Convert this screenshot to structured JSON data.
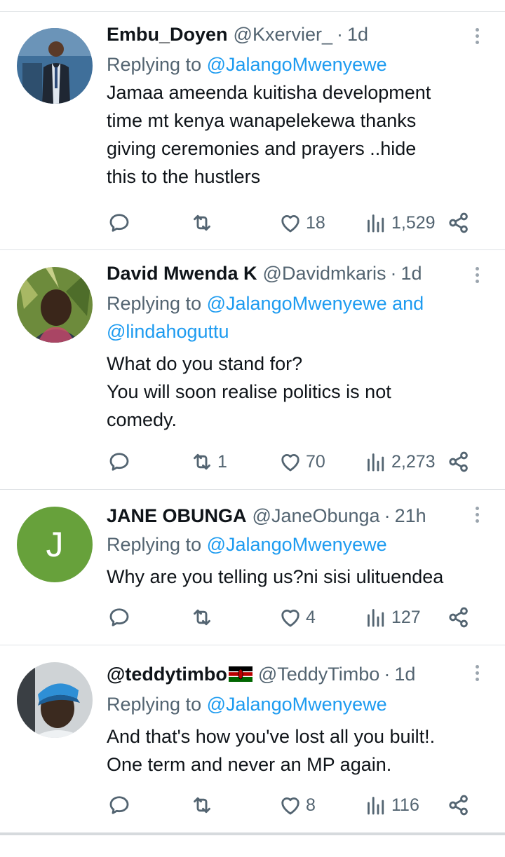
{
  "tweets": [
    {
      "name": "Embu_Doyen",
      "handle": "@Kxervier_",
      "dot": "·",
      "time": "1d",
      "replying_prefix": "Replying to",
      "replying_mentions": "@JalangoMwenyewe",
      "text": "Jamaa ameenda kuitisha development\ntime mt kenya wanapelekewa thanks\ngiving ceremonies and prayers ..hide\nthis to the hustlers",
      "retweets": "",
      "likes": "18",
      "views": "1,529"
    },
    {
      "name": "David Mwenda K",
      "handle": "@Davidmkaris",
      "dot": "·",
      "time": "1d",
      "replying_prefix": "Replying to",
      "replying_mentions": "@JalangoMwenyewe and\n@lindahoguttu",
      "text": "What do you stand for?\nYou will soon realise politics is not\ncomedy.",
      "retweets": "1",
      "likes": "70",
      "views": "2,273"
    },
    {
      "name": "JANE OBUNGA",
      "handle": "@JaneObunga",
      "dot": "·",
      "time": "21h",
      "avatar_letter": "J",
      "replying_prefix": "Replying to",
      "replying_mentions": "@JalangoMwenyewe",
      "text": "Why are you telling us?ni sisi ulituendea",
      "retweets": "",
      "likes": "4",
      "views": "127"
    },
    {
      "name": "@teddytimbo",
      "handle": "@TeddyTimbo",
      "dot": "·",
      "time": "1d",
      "replying_prefix": "Replying to",
      "replying_mentions": "@JalangoMwenyewe",
      "text": "And that's how you've lost all you built!.\nOne term and never an MP again.",
      "retweets": "",
      "likes": "8",
      "views": "116"
    }
  ],
  "icons": [
    "reply-icon",
    "retweet-icon",
    "heart-icon",
    "views-icon",
    "share-icon",
    "more-icon",
    "kenya-flag-icon"
  ],
  "colors": {
    "mention": "#1d9bf0",
    "secondary": "#536471",
    "avatar_j": "#67a13b"
  }
}
